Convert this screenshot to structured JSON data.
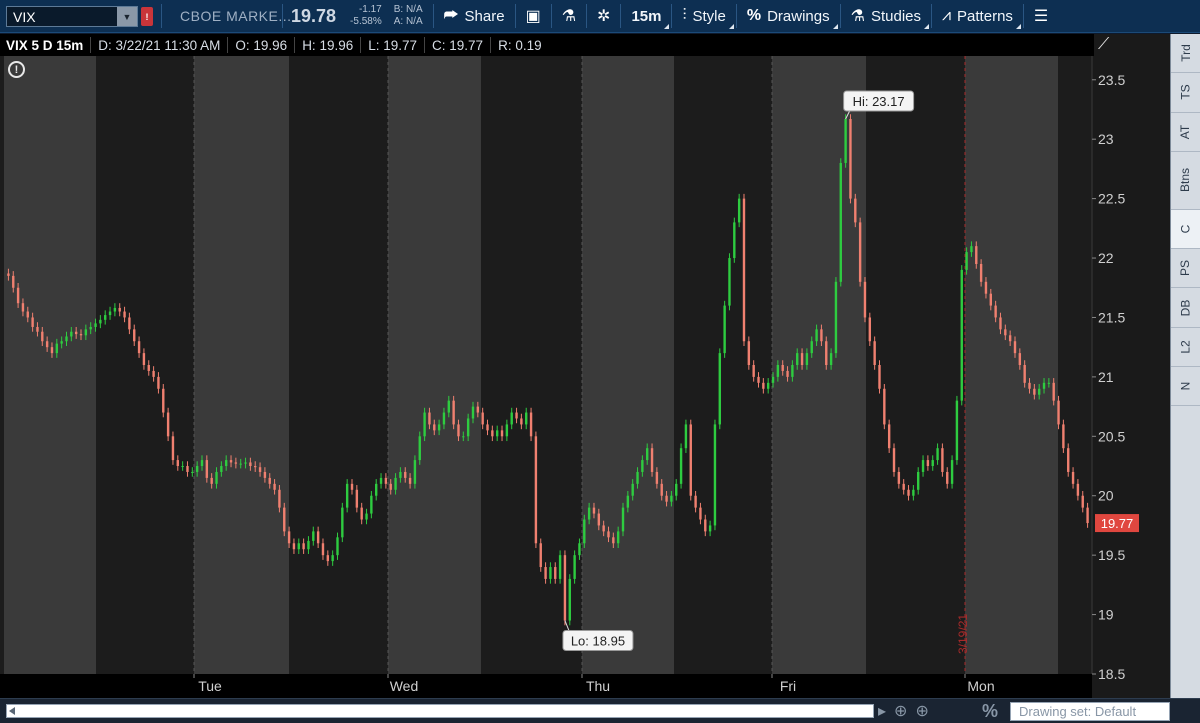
{
  "toolbar": {
    "symbol": "VIX",
    "alert_badge": "!",
    "description": "CBOE MARKE...",
    "last_price": "19.78",
    "net_change": "-1.17",
    "pct_change": "-5.58%",
    "bid": "B: N/A",
    "ask": "A: N/A",
    "share_label": "Share",
    "timeframe_label": "15m",
    "style_label": "Style",
    "drawings_label": "Drawings",
    "studies_label": "Studies",
    "patterns_label": "Patterns"
  },
  "infobar": {
    "title": "VIX 5 D 15m",
    "date": "D: 3/22/21 11:30 AM",
    "open": "O: 19.96",
    "high": "H: 19.96",
    "low": "L: 19.77",
    "close": "C: 19.77",
    "range": "R: 0.19"
  },
  "sidebar": {
    "items": [
      "Trd",
      "TS",
      "AT",
      "Btns",
      "C",
      "PS",
      "DB",
      "L2",
      "N"
    ]
  },
  "bottombar": {
    "drawing_set": "Drawing set: Default"
  },
  "chart_data": {
    "type": "candlestick",
    "ylim": [
      18.5,
      23.7
    ],
    "y_ticks": [
      "18.5",
      "19",
      "19.5",
      "20",
      "20.5",
      "21",
      "21.5",
      "22",
      "22.5",
      "23",
      "23.5"
    ],
    "x_labels": [
      "Tue",
      "Wed",
      "Thu",
      "Fri",
      "Mon"
    ],
    "last_label": "19.77",
    "hi_label": "Hi: 23.17",
    "lo_label": "Lo: 18.95",
    "date_marker": "3/19/21",
    "colors": {
      "up": "#2ecc40",
      "down": "#f08070",
      "last": "#e0473f",
      "shade_light": "#3a3a3a",
      "shade_dark": "#1c1c1c"
    },
    "sessions": [
      {
        "day": "Mon",
        "close": [
          21.85,
          21.75,
          21.62,
          21.55,
          21.5,
          21.42,
          21.38,
          21.3,
          21.25,
          21.2,
          21.28,
          21.3,
          21.34,
          21.38,
          21.36,
          21.35,
          21.4,
          21.42,
          21.45,
          21.48,
          21.52,
          21.55,
          21.58,
          21.55,
          21.5,
          21.4,
          21.3,
          21.2
        ]
      },
      {
        "day": "Tue",
        "close": [
          21.1,
          21.05,
          21.0,
          20.9,
          20.7,
          20.5,
          20.3,
          20.25,
          20.25,
          20.2,
          20.2,
          20.25,
          20.3,
          20.15,
          20.1,
          20.2,
          20.25,
          20.3,
          20.28,
          20.27,
          20.27,
          20.28,
          20.25,
          20.24,
          20.2,
          20.15,
          20.1,
          20.05
        ]
      },
      {
        "day": "Wed",
        "close": [
          19.9,
          19.7,
          19.6,
          19.55,
          19.6,
          19.55,
          19.62,
          19.7,
          19.6,
          19.5,
          19.45,
          19.5,
          19.65,
          19.9,
          20.1,
          20.05,
          19.9,
          19.8,
          19.85,
          20.0,
          20.1,
          20.15,
          20.1,
          20.05,
          20.15,
          20.2,
          20.15,
          20.1
        ]
      },
      {
        "day": "Thu",
        "close": [
          20.3,
          20.5,
          20.7,
          20.6,
          20.55,
          20.6,
          20.7,
          20.8,
          20.6,
          20.5,
          20.5,
          20.65,
          20.75,
          20.7,
          20.6,
          20.55,
          20.5,
          20.55,
          20.5,
          20.6,
          20.7,
          20.65,
          20.6,
          20.7,
          20.5,
          19.6,
          19.4,
          19.3
        ]
      },
      {
        "day": "Fri",
        "close": [
          19.4,
          19.3,
          19.5,
          18.95,
          19.3,
          19.5,
          19.6,
          19.8,
          19.9,
          19.85,
          19.75,
          19.7,
          19.65,
          19.6,
          19.7,
          19.9,
          20.0,
          20.1,
          20.2,
          20.3,
          20.4,
          20.2,
          20.1,
          20.0,
          19.95,
          20.0,
          20.1,
          20.4,
          20.6,
          20.0,
          19.9,
          19.8,
          19.7,
          19.75,
          20.6,
          21.2,
          21.6,
          22.0,
          22.3,
          22.5,
          21.3,
          21.1,
          21.0,
          20.95,
          20.9,
          20.95,
          21.0,
          21.1,
          21.05,
          21.0,
          21.1,
          21.2,
          21.1,
          21.2,
          21.3,
          21.4,
          21.3,
          21.1,
          21.2,
          21.8,
          22.8,
          23.17,
          22.5,
          22.3,
          21.8,
          21.5,
          21.3,
          21.1,
          20.9,
          20.6,
          20.4,
          20.2,
          20.1,
          20.05,
          20.0,
          20.05,
          20.2,
          20.3,
          20.25,
          20.3,
          20.4,
          20.2,
          20.1,
          20.3,
          20.8
        ]
      }
    ],
    "final_session": {
      "day": "Mon",
      "close": [
        21.9,
        22.05,
        22.1,
        21.95,
        21.8,
        21.7,
        21.6,
        21.5,
        21.4,
        21.35,
        21.3,
        21.2,
        21.1,
        20.95,
        20.9,
        20.85,
        20.9,
        20.95,
        20.95,
        20.8,
        20.6,
        20.4,
        20.2,
        20.1,
        20.0,
        19.9,
        19.77
      ]
    }
  }
}
